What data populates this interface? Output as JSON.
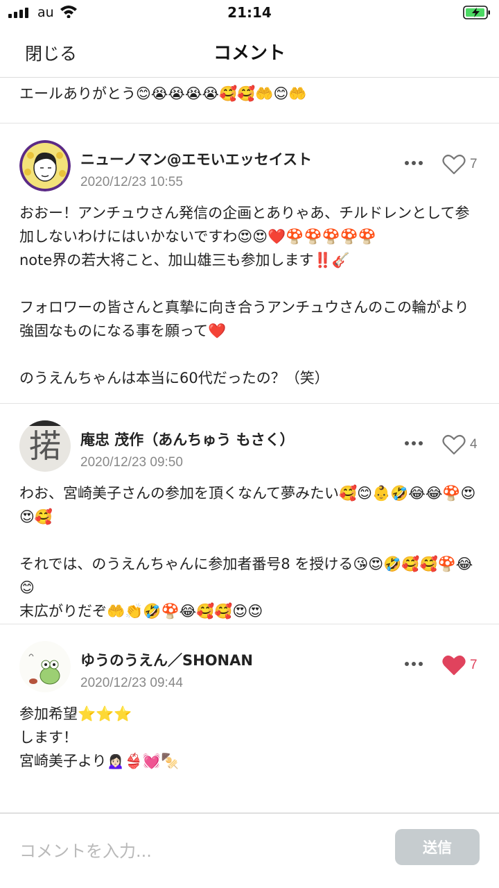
{
  "status_bar": {
    "carrier": "au",
    "time": "21:14"
  },
  "header": {
    "close_label": "閉じる",
    "title": "コメント"
  },
  "partial_comment": {
    "text": "エールありがとう😊😭😭😭😭🥰🥰🤲😊🤲"
  },
  "comments": [
    {
      "author": "ニューノマン@エモいエッセイスト",
      "timestamp": "2020/12/23 10:55",
      "likes": "7",
      "liked": false,
      "body": "おおー！アンチュウさん発信の企画とありゃあ、チルドレンとして参加しないわけにはいかないですわ😍😍❤️🍄🍄🍄🍄🍄\nnote界の若大将こと、加山雄三も参加します‼️🎸\n\nフォロワーの皆さんと真摯に向き合うアンチュウさんのこの輪がより強固なものになる事を願って❤️\n\nのうえんちゃんは本当に60代だったの？（笑）"
    },
    {
      "author": "庵忠 茂作（あんちゅう もさく）",
      "timestamp": "2020/12/23 09:50",
      "likes": "4",
      "liked": false,
      "avatar_char": "掿",
      "body": "わお、宮崎美子さんの参加を頂くなんて夢みたい🥰😊👶🤣😂😂🍄😍😍🥰\n\nそれでは、のうえんちゃんに参加者番号8 を授ける😘😍🤣🥰🥰🍄😂😊\n末広がりだぞ🤲👏🤣🍄😂🥰🥰😍😍"
    },
    {
      "author": "ゆうのうえん／SHONAN",
      "timestamp": "2020/12/23 09:44",
      "likes": "7",
      "liked": true,
      "body": "参加希望⭐️⭐️⭐️\nします！\n宮崎美子より🙍🏻‍♀️👙💓🍢"
    }
  ],
  "input": {
    "placeholder": "コメントを入力...",
    "send_label": "送信"
  },
  "colors": {
    "like_active": "#e0435d",
    "send_disabled": "#c6cccf"
  },
  "icons": [
    "signal-icon",
    "wifi-icon",
    "battery-charging-icon",
    "more-icon",
    "heart-icon"
  ]
}
